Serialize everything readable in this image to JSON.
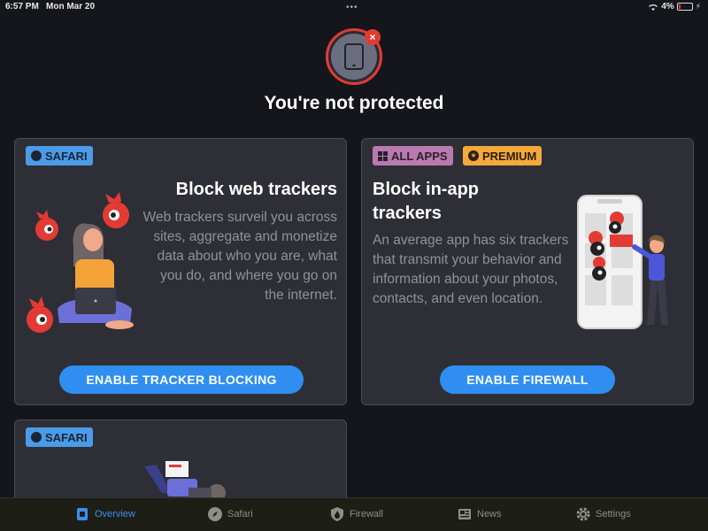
{
  "status_bar": {
    "time": "6:57 PM",
    "date": "Mon Mar 20",
    "battery": "4%"
  },
  "hero": {
    "title": "You're not protected"
  },
  "cards": {
    "web": {
      "badge": "SAFARI",
      "title": "Block web trackers",
      "description": "Web trackers surveil you across sites, aggregate and monetize data about who you are, what you do, and where you go on the internet.",
      "button": "ENABLE TRACKER BLOCKING"
    },
    "app": {
      "badge_all_apps": "ALL APPS",
      "badge_premium": "PREMIUM",
      "title": "Block in-app trackers",
      "description": "An average app has six trackers that transmit your behavior and information about your photos, contacts, and even location.",
      "button": "ENABLE FIREWALL"
    },
    "third": {
      "badge": "SAFARI"
    }
  },
  "tabs": [
    {
      "label": "Overview",
      "icon": "overview-icon",
      "active": true
    },
    {
      "label": "Safari",
      "icon": "compass-icon",
      "active": false
    },
    {
      "label": "Firewall",
      "icon": "flame-shield-icon",
      "active": false
    },
    {
      "label": "News",
      "icon": "newspaper-icon",
      "active": false
    },
    {
      "label": "Settings",
      "icon": "gear-icon",
      "active": false
    }
  ],
  "colors": {
    "accent": "#2f8ef0",
    "danger": "#e33b34",
    "safari_badge": "#4a9be8",
    "all_apps_badge": "#b97ab0",
    "premium_badge": "#f4a93a"
  }
}
